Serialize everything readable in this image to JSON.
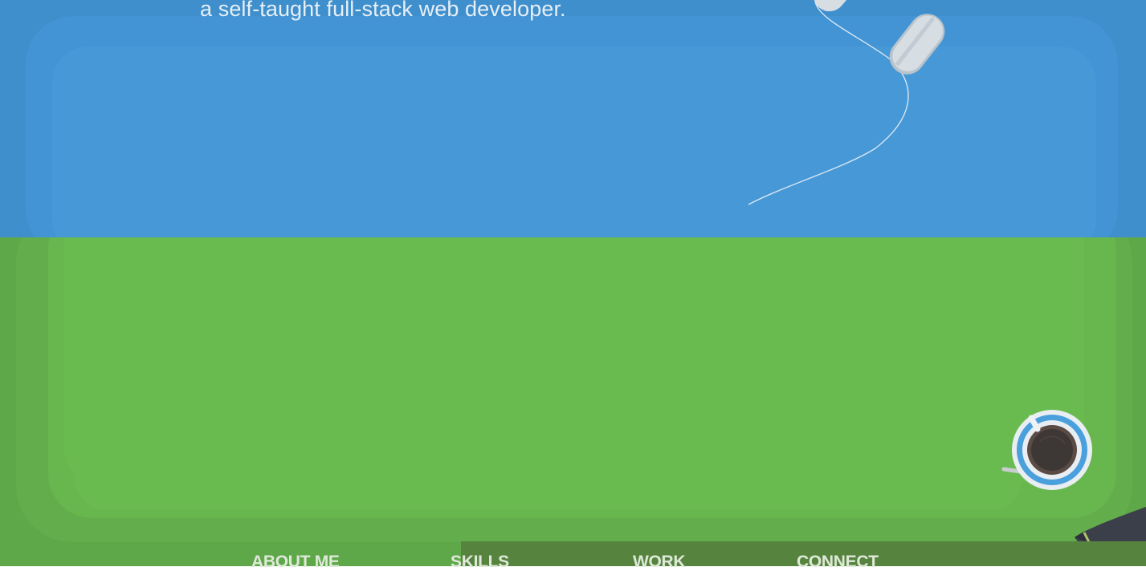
{
  "hero": {
    "tagline": "a self-taught full-stack web developer."
  },
  "nav": {
    "items": [
      {
        "label": "ABOUT ME"
      },
      {
        "label": "SKILLS"
      },
      {
        "label": "WORK"
      },
      {
        "label": "CONNECT"
      }
    ]
  },
  "colors": {
    "hero_blue": "#4698d6",
    "desk_green": "#6abb4f",
    "nav_strip": "#56843f",
    "cup_accent": "#4aa0dc"
  },
  "icons": {
    "mouse": "computer-mouse-icon",
    "cup": "coffee-cup-icon",
    "pen": "pen-icon"
  }
}
